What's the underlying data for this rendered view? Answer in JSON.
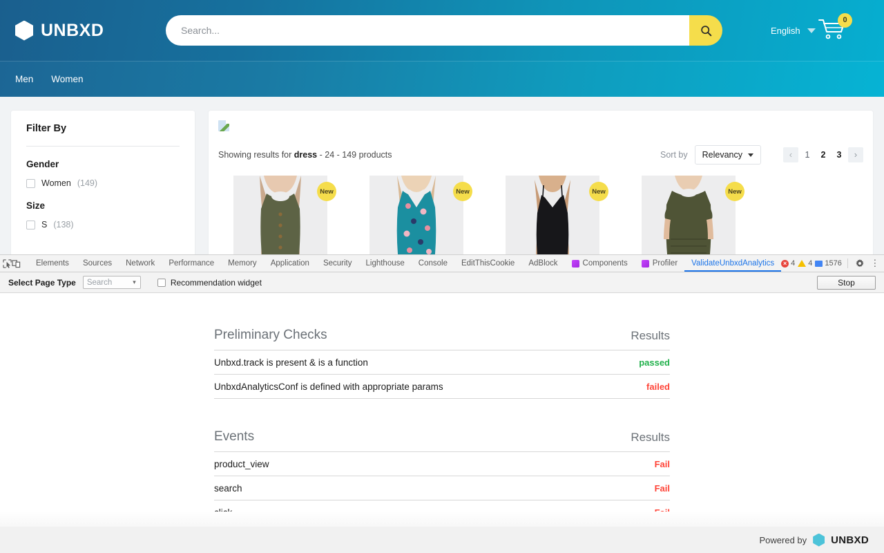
{
  "site": {
    "brand": "UNBXD",
    "brand_icon": "hexagon-logo-icon",
    "search_placeholder": "Search...",
    "search_value": "",
    "search_icon": "search-icon",
    "language": "English",
    "language_caret_icon": "chevron-down-icon",
    "cart_icon": "shopping-cart-icon",
    "cart_count": "0",
    "nav": [
      {
        "label": "Men"
      },
      {
        "label": "Women"
      }
    ]
  },
  "facets": {
    "title": "Filter By",
    "groups": [
      {
        "name": "Gender",
        "options": [
          {
            "label": "Women",
            "count": "(149)"
          }
        ]
      },
      {
        "name": "Size",
        "options": [
          {
            "label": "S",
            "count": "(138)"
          }
        ]
      }
    ]
  },
  "results": {
    "broken_image_icon": "broken-image-icon",
    "summary_prefix": "Showing results for ",
    "query": "dress",
    "summary_suffix": " - 24 - 149 products",
    "sort_label": "Sort by",
    "sort_value": "Relevancy",
    "sort_caret_icon": "caret-down-icon",
    "pagination": {
      "prev_icon": "chevron-left-icon",
      "next_icon": "chevron-right-icon",
      "pages": [
        "1",
        "2",
        "3"
      ],
      "current": "2"
    },
    "products": [
      {
        "badge": "New",
        "alt": "olive sleeveless button front top"
      },
      {
        "badge": "New",
        "alt": "teal floral wrap dress"
      },
      {
        "badge": "New",
        "alt": "black cami slip dress"
      },
      {
        "badge": "New",
        "alt": "olive ruched t-shirt dress"
      }
    ]
  },
  "devtools": {
    "inspect_icon": "inspect-element-icon",
    "device_icon": "device-toolbar-icon",
    "tabs": [
      {
        "label": "Elements",
        "active": false,
        "icon": null
      },
      {
        "label": "Sources",
        "active": false,
        "icon": null
      },
      {
        "label": "Network",
        "active": false,
        "icon": null
      },
      {
        "label": "Performance",
        "active": false,
        "icon": null
      },
      {
        "label": "Memory",
        "active": false,
        "icon": null
      },
      {
        "label": "Application",
        "active": false,
        "icon": null
      },
      {
        "label": "Security",
        "active": false,
        "icon": null
      },
      {
        "label": "Lighthouse",
        "active": false,
        "icon": null
      },
      {
        "label": "Console",
        "active": false,
        "icon": null
      },
      {
        "label": "EditThisCookie",
        "active": false,
        "icon": null
      },
      {
        "label": "AdBlock",
        "active": false,
        "icon": null
      },
      {
        "label": "Components",
        "active": false,
        "icon": "extension-icon"
      },
      {
        "label": "Profiler",
        "active": false,
        "icon": "extension-icon"
      },
      {
        "label": "ValidateUnbxdAnalytics",
        "active": true,
        "icon": null
      }
    ],
    "status": {
      "errors_icon": "error-circle-icon",
      "errors": "4",
      "warnings_icon": "warning-triangle-icon",
      "warnings": "4",
      "messages_icon": "message-box-icon",
      "messages": "1576",
      "settings_icon": "gear-icon",
      "more_icon": "kebab-menu-icon",
      "close_icon": "close-icon"
    },
    "toolbar": {
      "page_type_label": "Select Page Type",
      "page_type_value": "Search",
      "page_type_caret_icon": "chevron-down-icon",
      "recommendation_label": "Recommendation widget",
      "recommendation_checked": false,
      "stop_label": "Stop"
    },
    "preliminary": {
      "title": "Preliminary Checks",
      "results_header": "Results",
      "rows": [
        {
          "label": "Unbxd.track is present & is a function",
          "result": "passed",
          "state": "ok"
        },
        {
          "label": "UnbxdAnalyticsConf is defined with appropriate params",
          "result": "failed",
          "state": "bad"
        }
      ]
    },
    "events": {
      "title": "Events",
      "results_header": "Results",
      "rows": [
        {
          "label": "product_view",
          "result": "Fail",
          "state": "bad"
        },
        {
          "label": "search",
          "result": "Fail",
          "state": "bad"
        },
        {
          "label": "click",
          "result": "Fail",
          "state": "bad"
        }
      ]
    },
    "footer": {
      "text": "Powered by",
      "brand": "UNBXD",
      "brand_icon": "hexagon-logo-icon"
    }
  },
  "colors": {
    "header_start": "#1a5f8e",
    "header_end": "#06aed0",
    "accent_yellow": "#f5dd4b",
    "pass_green": "#22b14c",
    "fail_red": "#ff4438",
    "devtools_active": "#1a73e8"
  }
}
